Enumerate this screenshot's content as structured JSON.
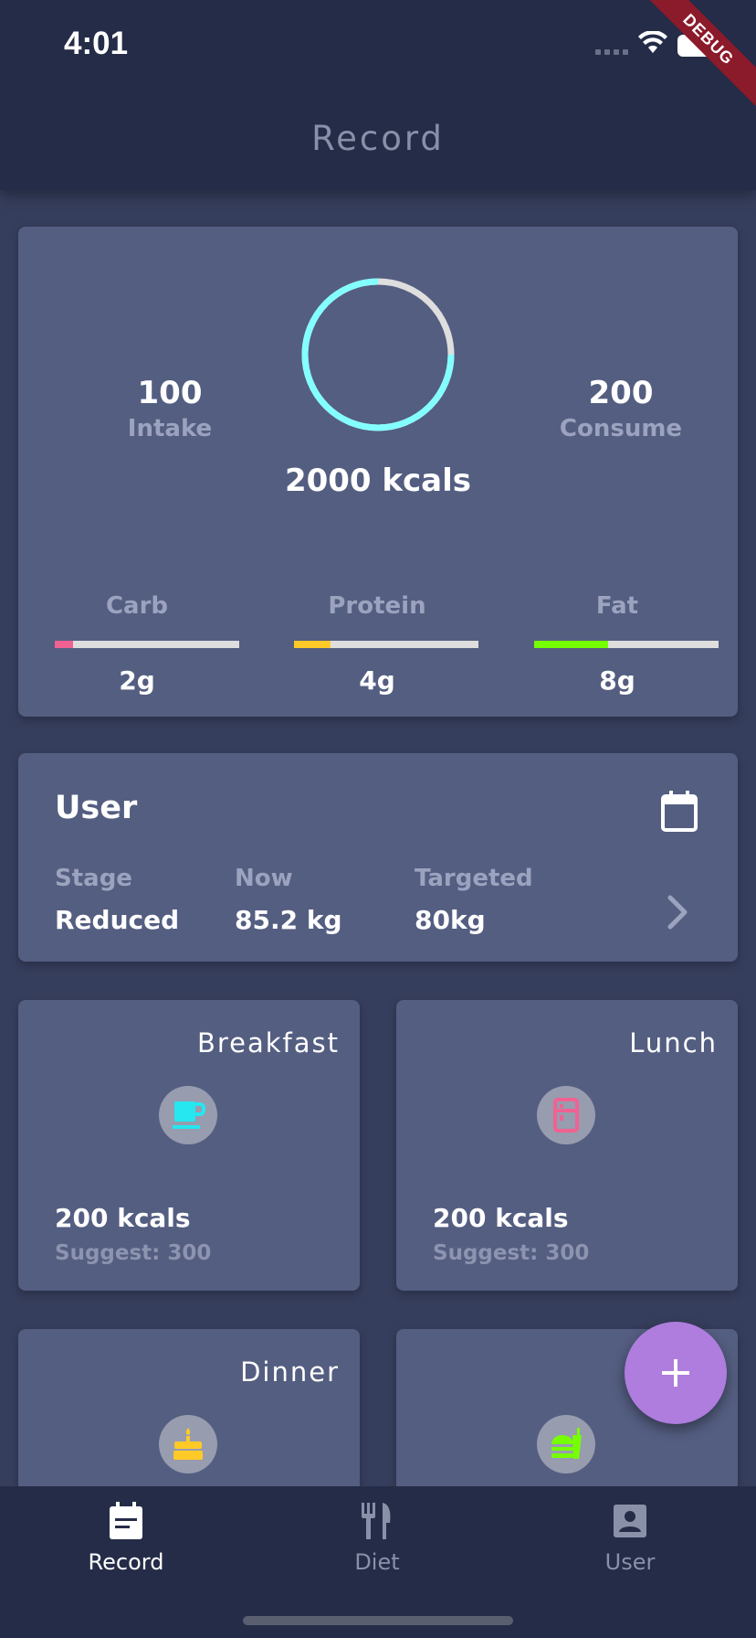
{
  "status_bar": {
    "time": "4:01",
    "debug_label": "DEBUG"
  },
  "app_bar": {
    "title": "Record"
  },
  "summary": {
    "intake_value": "100",
    "intake_label": "Intake",
    "consume_value": "200",
    "consume_label": "Consume",
    "total_kcal": "2000 kcals",
    "ring_progress": 0.75,
    "macros": [
      {
        "label": "Carb",
        "value": "2g",
        "fill_fraction": 0.1,
        "color": "#f06292"
      },
      {
        "label": "Protein",
        "value": "4g",
        "fill_fraction": 0.2,
        "color": "#ffca28"
      },
      {
        "label": "Fat",
        "value": "8g",
        "fill_fraction": 0.4,
        "color": "#76ff03"
      }
    ]
  },
  "user_card": {
    "title": "User",
    "stage_label": "Stage",
    "stage_value": "Reduced",
    "now_label": "Now",
    "now_value": "85.2 kg",
    "target_label": "Targeted",
    "target_value": "80kg"
  },
  "meals": [
    {
      "title": "Breakfast",
      "kcal": "200 kcals",
      "suggest": "Suggest: 300",
      "icon": "coffee-cup-icon",
      "icon_color": "#26e6f0"
    },
    {
      "title": "Lunch",
      "kcal": "200 kcals",
      "suggest": "Suggest: 300",
      "icon": "fridge-icon",
      "icon_color": "#f06292"
    },
    {
      "title": "Dinner",
      "icon": "cake-icon",
      "icon_color": "#ffca28"
    },
    {
      "title": "",
      "icon": "fastfood-icon",
      "icon_color": "#76ff03"
    }
  ],
  "bottom_nav": {
    "items": [
      {
        "label": "Record",
        "active": true
      },
      {
        "label": "Diet",
        "active": false
      },
      {
        "label": "User",
        "active": false
      }
    ]
  },
  "colors": {
    "background": "#363e5d",
    "card": "#545e81",
    "app_bar": "#252c48",
    "ring": "#84ffff",
    "ring_track": "#dedede",
    "fab": "#ae7ddd"
  }
}
